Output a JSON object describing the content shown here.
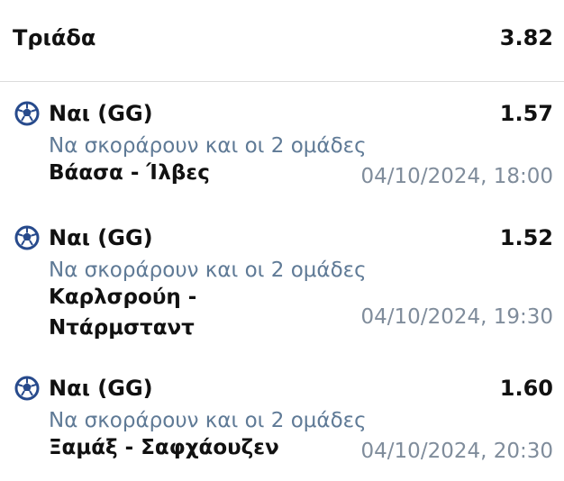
{
  "header": {
    "title": "Τριάδα",
    "odds": "3.82"
  },
  "icons": {
    "sport": "soccer-ball-icon",
    "color": "#274a8c"
  },
  "bets": [
    {
      "selection": "Ναι (GG)",
      "odds": "1.57",
      "market": "Να σκοράρουν και οι 2 ομάδες",
      "match_line1": "Βάασα - Ίλβες",
      "match_line2": "",
      "datetime": "04/10/2024, 18:00"
    },
    {
      "selection": "Ναι (GG)",
      "odds": "1.52",
      "market": "Να σκοράρουν και οι 2 ομάδες",
      "match_line1": "Καρλσρούη -",
      "match_line2": "Ντάρμσταντ",
      "datetime": "04/10/2024, 19:30"
    },
    {
      "selection": "Ναι (GG)",
      "odds": "1.60",
      "market": "Να σκοράρουν και οι 2 ομάδες",
      "match_line1": "Ξαμάξ - Σαφχάουζεν",
      "match_line2": "",
      "datetime": "04/10/2024, 20:30"
    }
  ]
}
